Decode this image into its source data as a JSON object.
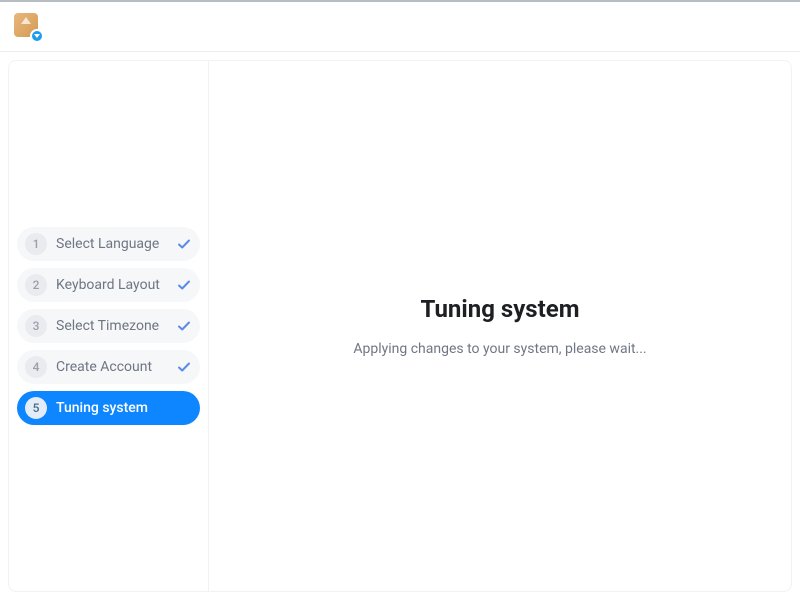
{
  "sidebar": {
    "steps": [
      {
        "number": "1",
        "label": "Select Language"
      },
      {
        "number": "2",
        "label": "Keyboard Layout"
      },
      {
        "number": "3",
        "label": "Select Timezone"
      },
      {
        "number": "4",
        "label": "Create Account"
      },
      {
        "number": "5",
        "label": "Tuning system"
      }
    ]
  },
  "main": {
    "title": "Tuning system",
    "subtitle": "Applying changes to your system, please wait..."
  }
}
